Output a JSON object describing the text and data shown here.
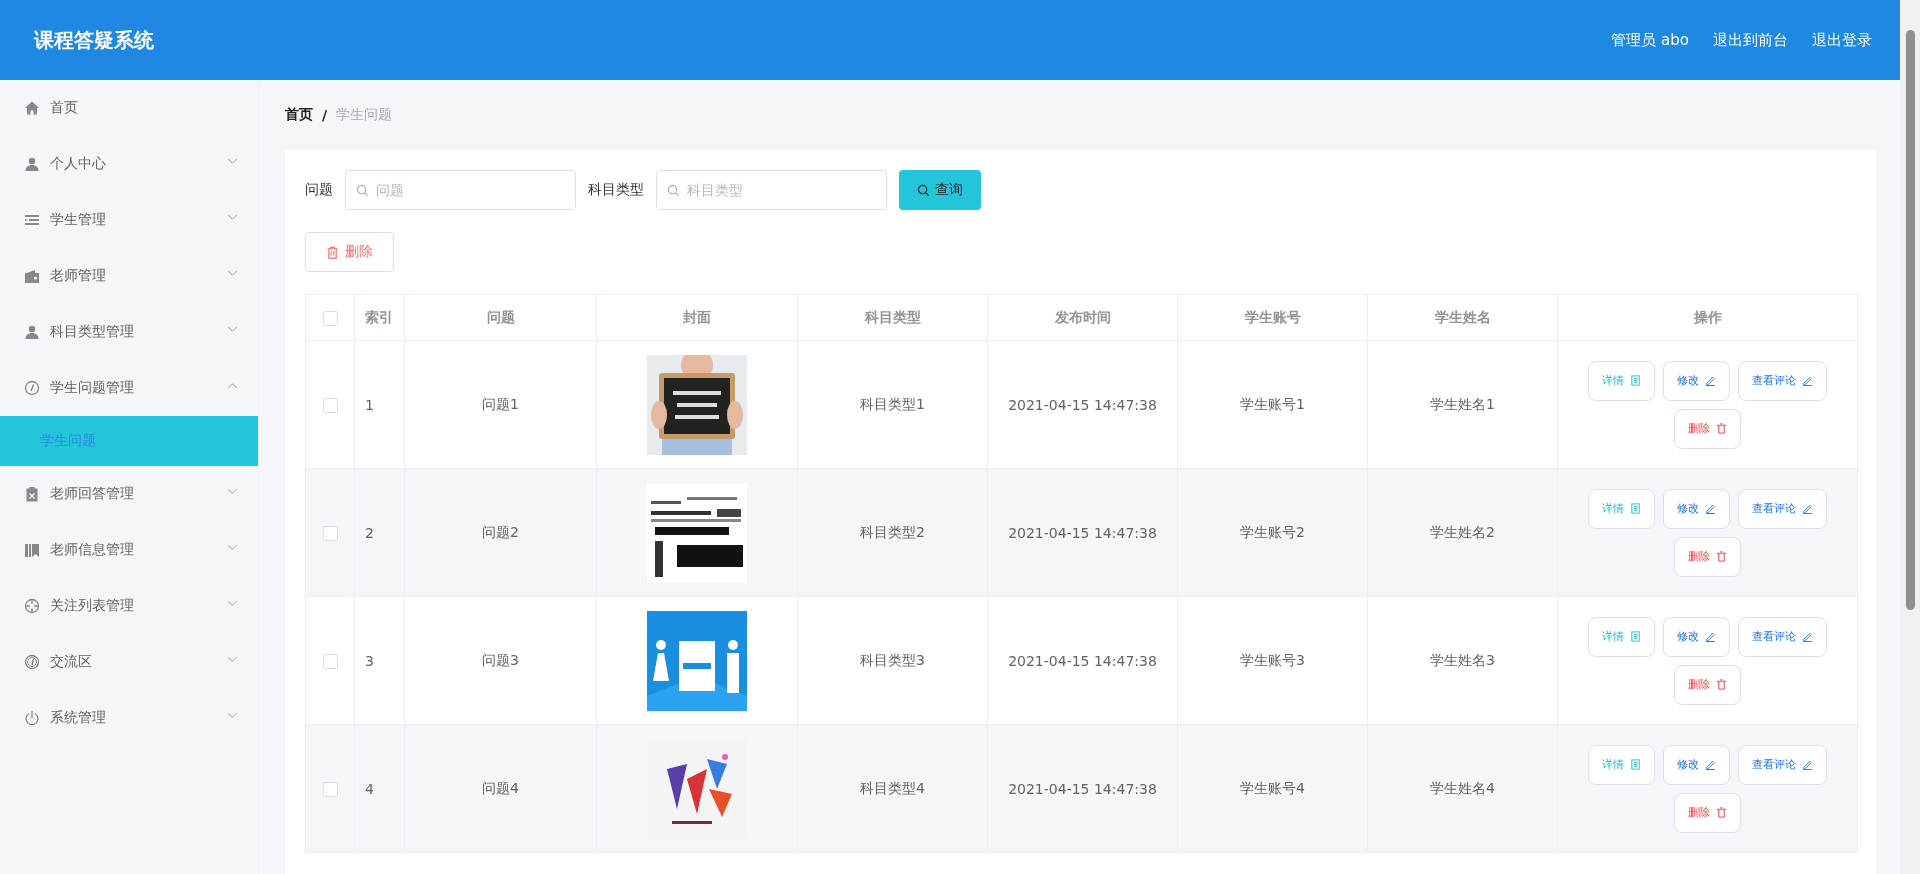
{
  "header": {
    "title": "课程答疑系统",
    "user": "管理员 abo",
    "links": [
      "退出到前台",
      "退出登录"
    ]
  },
  "sidebar": {
    "items": [
      {
        "label": "首页",
        "selected": false
      },
      {
        "label": "个人中心",
        "selected": false,
        "expanded": false
      },
      {
        "label": "学生管理",
        "selected": false,
        "expanded": false
      },
      {
        "label": "老师管理",
        "selected": false,
        "expanded": false
      },
      {
        "label": "科目类型管理",
        "selected": false,
        "expanded": false
      },
      {
        "label": "学生问题管理",
        "selected": false,
        "expanded": true,
        "children": [
          {
            "label": "学生问题",
            "selected": true
          }
        ]
      },
      {
        "label": "老师回答管理",
        "selected": false,
        "expanded": false
      },
      {
        "label": "老师信息管理",
        "selected": false,
        "expanded": false
      },
      {
        "label": "关注列表管理",
        "selected": false,
        "expanded": false
      },
      {
        "label": "交流区",
        "selected": false,
        "expanded": false
      },
      {
        "label": "系统管理",
        "selected": false,
        "expanded": false
      }
    ]
  },
  "breadcrumb": {
    "items": [
      "首页",
      "学生问题"
    ],
    "separator": "/"
  },
  "search": {
    "fields": [
      {
        "label": "问题",
        "placeholder": "问题"
      },
      {
        "label": "科目类型",
        "placeholder": "科目类型"
      }
    ],
    "button": "查询"
  },
  "toolbar": {
    "delete_button": "删除"
  },
  "table": {
    "header_checked": false,
    "columns": [
      "索引",
      "问题",
      "封面",
      "科目类型",
      "发布时间",
      "学生账号",
      "学生姓名",
      "操作"
    ],
    "rows": [
      {
        "checked": false,
        "index": "1",
        "question": "问题1",
        "subject": "科目类型1",
        "time": "2021-04-15 14:47:38",
        "account": "学生账号1",
        "name": "学生姓名1",
        "actions": [
          {
            "kind": "detail",
            "label": "详情"
          },
          {
            "kind": "edit",
            "label": "修改"
          },
          {
            "kind": "comment",
            "label": "查看评论"
          },
          {
            "kind": "delete",
            "label": "删除"
          }
        ]
      },
      {
        "checked": false,
        "index": "2",
        "question": "问题2",
        "subject": "科目类型2",
        "time": "2021-04-15 14:47:38",
        "account": "学生账号2",
        "name": "学生姓名2",
        "actions": [
          {
            "kind": "detail",
            "label": "详情"
          },
          {
            "kind": "edit",
            "label": "修改"
          },
          {
            "kind": "comment",
            "label": "查看评论"
          },
          {
            "kind": "delete",
            "label": "删除"
          }
        ]
      },
      {
        "checked": false,
        "index": "3",
        "question": "问题3",
        "subject": "科目类型3",
        "time": "2021-04-15 14:47:38",
        "account": "学生账号3",
        "name": "学生姓名3",
        "actions": [
          {
            "kind": "detail",
            "label": "详情"
          },
          {
            "kind": "edit",
            "label": "修改"
          },
          {
            "kind": "comment",
            "label": "查看评论"
          },
          {
            "kind": "delete",
            "label": "删除"
          }
        ]
      },
      {
        "checked": false,
        "index": "4",
        "question": "问题4",
        "subject": "科目类型4",
        "time": "2021-04-15 14:47:38",
        "account": "学生账号4",
        "name": "学生姓名4",
        "actions": [
          {
            "kind": "detail",
            "label": "详情"
          },
          {
            "kind": "edit",
            "label": "修改"
          },
          {
            "kind": "comment",
            "label": "查看评论"
          },
          {
            "kind": "delete",
            "label": "删除"
          }
        ]
      }
    ]
  }
}
